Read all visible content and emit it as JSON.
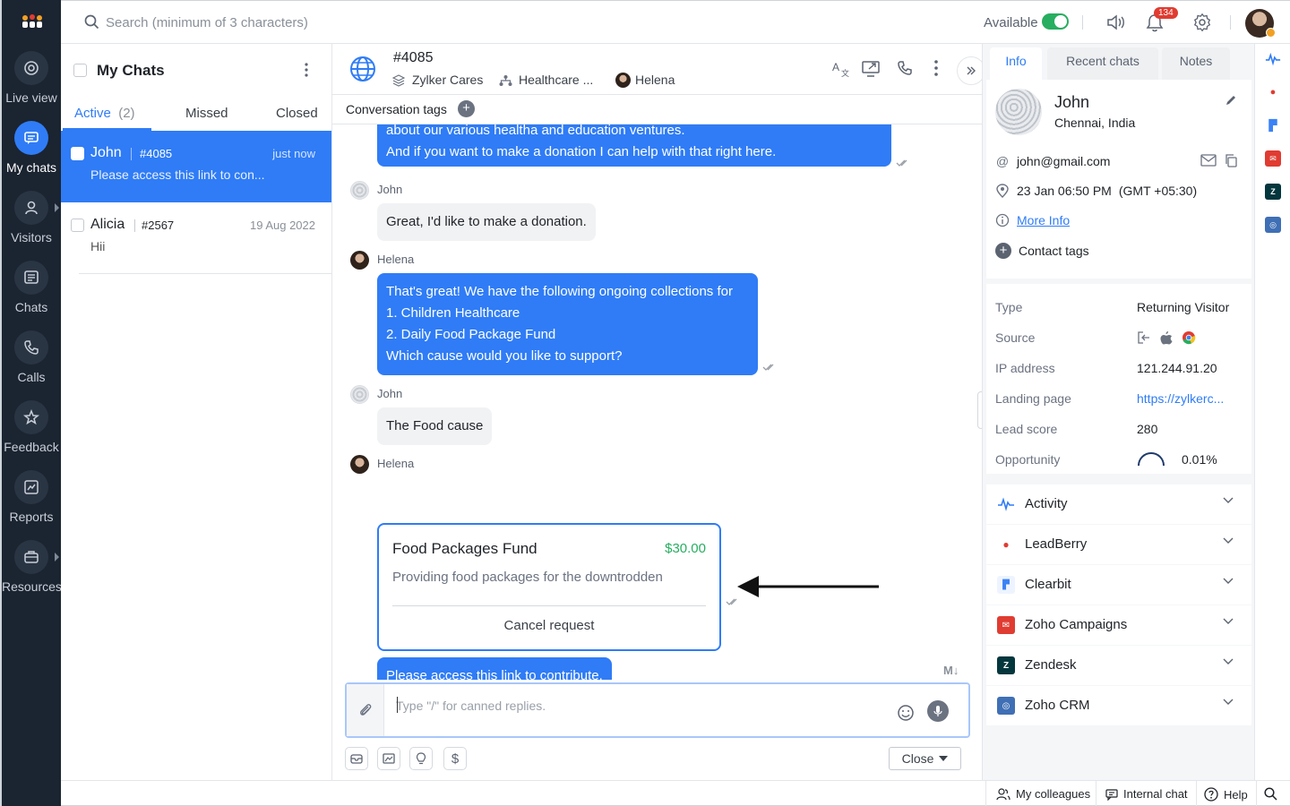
{
  "nav": {
    "items": [
      {
        "label": "Live view",
        "icon": "live-view-icon"
      },
      {
        "label": "My chats",
        "icon": "chat-bubble-icon",
        "active": true
      },
      {
        "label": "Visitors",
        "icon": "person-icon"
      },
      {
        "label": "Chats",
        "icon": "chats-icon"
      },
      {
        "label": "Calls",
        "icon": "phone-icon"
      },
      {
        "label": "Feedback",
        "icon": "star-icon"
      },
      {
        "label": "Reports",
        "icon": "chart-icon"
      },
      {
        "label": "Resources",
        "icon": "briefcase-icon"
      }
    ]
  },
  "topbar": {
    "search_placeholder": "Search (minimum of 3 characters)",
    "availability": "Available",
    "notification_count": "134"
  },
  "chatlist": {
    "title": "My Chats",
    "tabs": {
      "active": "Active",
      "active_count": "(2)",
      "missed": "Missed",
      "closed": "Closed"
    },
    "rows": [
      {
        "name": "John",
        "ticket": "#4085",
        "time": "just now",
        "message": "Please access this link to con..."
      },
      {
        "name": "Alicia",
        "ticket": "#2567",
        "time": "19 Aug 2022",
        "message": "Hii"
      }
    ]
  },
  "conversation": {
    "id": "#4085",
    "department": "Zylker Cares",
    "group": "Healthcare ...",
    "agent": "Helena",
    "tags_label": "Conversation tags",
    "messages": {
      "m1_line1": "about our various healtha and education ventures.",
      "m1_line2": "And if you want to make a donation I can help with that right here.",
      "john_name": "John",
      "m2": "Great, I'd like to make a donation.",
      "helena_name": "Helena",
      "m3_line1": "That's great! We have the following ongoing collections for",
      "m3_line2": "1. Children Healthcare",
      "m3_line3": "2. Daily Food Package Fund",
      "m3_line4": "Which cause would you like to support?",
      "m4": "The Food cause",
      "m5": "Please access this link to contribute."
    },
    "payment_card": {
      "title": "Food Packages Fund",
      "price": "$30.00",
      "description": "Providing food packages for the downtrodden",
      "cancel_label": "Cancel request"
    },
    "markdown_label": "M↓",
    "composer_placeholder": "Type \"/\" for canned replies.",
    "close_label": "Close"
  },
  "info": {
    "tabs": [
      "Info",
      "Recent chats",
      "Notes"
    ],
    "visitor": {
      "name": "John",
      "location": "Chennai, India",
      "email": "john@gmail.com",
      "datetime": "23 Jan 06:50 PM",
      "timezone": "(GMT +05:30)",
      "more_info": "More Info",
      "contact_tags": "Contact tags"
    },
    "details": {
      "type_label": "Type",
      "type_value": "Returning Visitor",
      "source_label": "Source",
      "ip_label": "IP address",
      "ip_value": "121.244.91.20",
      "landing_label": "Landing page",
      "landing_value": "https://zylkerc...",
      "lead_label": "Lead score",
      "lead_value": "280",
      "opp_label": "Opportunity",
      "opp_value": "0.01%"
    },
    "integrations": [
      {
        "name": "Activity",
        "color": "#2f7cf6"
      },
      {
        "name": "LeadBerry",
        "color": "#e03c31"
      },
      {
        "name": "Clearbit",
        "color": "#3b82f6"
      },
      {
        "name": "Zoho Campaigns",
        "color": "#e03c31"
      },
      {
        "name": "Zendesk",
        "color": "#03363d"
      },
      {
        "name": "Zoho CRM",
        "color": "#3f6fb5"
      }
    ]
  },
  "bottombar": {
    "colleagues": "My colleagues",
    "internal_chat": "Internal chat",
    "help": "Help"
  }
}
